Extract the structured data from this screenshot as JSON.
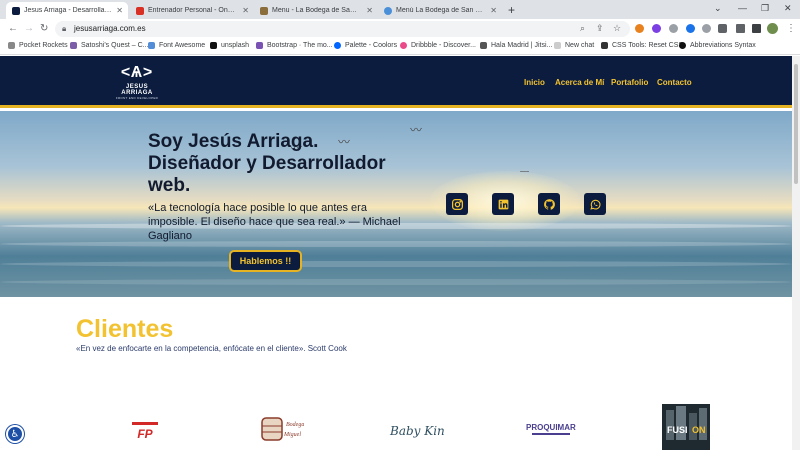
{
  "browser": {
    "tabs": [
      {
        "title": "Jesus Arriaga - Desarrollador Fro",
        "active": true,
        "color": "#0b1c3e"
      },
      {
        "title": "Entrenador Personal - Online - Fi",
        "active": false,
        "color": "#d93025"
      },
      {
        "title": "Menu - La Bodega de San Miguel",
        "active": false,
        "color": "#8a6d3b"
      },
      {
        "title": "Menú La Bodega de San Miguel",
        "active": false,
        "color": "#4a90d9"
      }
    ],
    "new_tab_icon": "+",
    "url": "jesusarriaga.com.es",
    "bookmarks": [
      {
        "label": "Pocket Rockets",
        "color": "#888888"
      },
      {
        "label": "Satoshi's Quest – C...",
        "color": "#7b5ea7"
      },
      {
        "label": "Font Awesome",
        "color": "#538dd7"
      },
      {
        "label": "unsplash",
        "color": "#111111"
      },
      {
        "label": "Bootstrap · The mo...",
        "color": "#7952b3"
      },
      {
        "label": "Palette - Coolors",
        "color": "#0066ff"
      },
      {
        "label": "Dribbble - Discover...",
        "color": "#ea4c89"
      },
      {
        "label": "Hala Madrid | Jitsi...",
        "color": "#555555"
      },
      {
        "label": "New chat",
        "color": "#cccccc"
      },
      {
        "label": "CSS Tools: Reset CSS",
        "color": "#333333"
      },
      {
        "label": "Abbreviations Syntax",
        "color": "#111111"
      }
    ]
  },
  "nav": {
    "logo_mark": "<Ѧ>",
    "logo_name": "JESUS ARRIAGA",
    "logo_sub": "FRONT END DEVELOPER",
    "items": [
      "Inicio",
      "Acerca de Mí",
      "Portafolio",
      "Contacto"
    ]
  },
  "hero": {
    "title": "Soy Jesús Arriaga. Diseñador y Desarrollador web.",
    "quote": "«La tecnología hace posible lo que antes era imposible. El diseño hace que sea real.» — Michael Gagliano",
    "cta": "Hablemos !!",
    "social": [
      "instagram-icon",
      "linkedin-icon",
      "github-icon",
      "whatsapp-icon"
    ]
  },
  "clients": {
    "title": "Clientes",
    "quote": "«En vez de enfocarte en la competencia, enfócate en el cliente». Scott Cook",
    "logos": [
      {
        "label": "FP",
        "caption": "FUERZA PURA",
        "color": "#d22828"
      },
      {
        "label": "Bodega",
        "caption": "San Miguel",
        "color": "#8a3b2b"
      },
      {
        "label": "Baby King",
        "caption": "",
        "color": "#2f4f5f"
      },
      {
        "label": "PROQUIMAR",
        "caption": "",
        "color": "#4a3f8f"
      },
      {
        "label": "FUSION",
        "caption": "",
        "color": "#f2c230"
      }
    ]
  }
}
